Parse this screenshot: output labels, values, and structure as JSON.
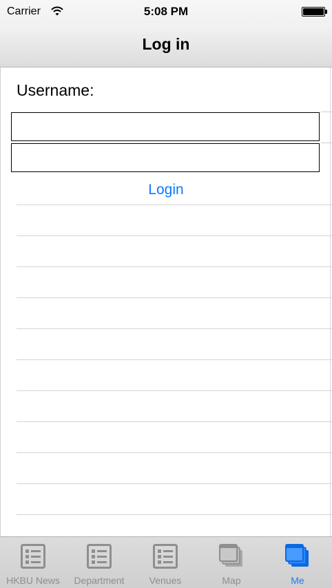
{
  "status_bar": {
    "carrier": "Carrier",
    "time": "5:08 PM"
  },
  "nav": {
    "title": "Log in"
  },
  "form": {
    "username_label": "Username:",
    "username_value": "",
    "password_value": "",
    "login_label": "Login"
  },
  "tabs": [
    {
      "label": "HKBU News",
      "icon": "list-icon",
      "active": false
    },
    {
      "label": "Department",
      "icon": "list-icon",
      "active": false
    },
    {
      "label": "Venues",
      "icon": "list-icon",
      "active": false
    },
    {
      "label": "Map",
      "icon": "stacked-windows-icon",
      "active": false
    },
    {
      "label": "Me",
      "icon": "stacked-windows-icon",
      "active": true
    }
  ],
  "colors": {
    "accent": "#0a7aff",
    "tab_inactive": "#8e8e8e"
  }
}
